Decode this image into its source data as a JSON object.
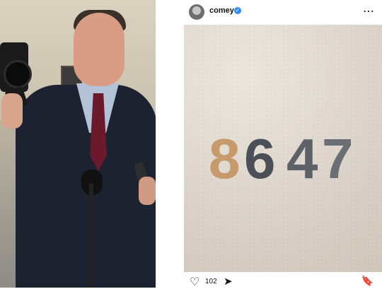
{
  "post": {
    "username": "comey",
    "verified_icon": "verified-badge-icon",
    "more_icon": "more-options-icon",
    "likes_count": "102",
    "actions": {
      "like_icon": "heart-icon",
      "share_icon": "send-icon",
      "save_icon": "bookmark-icon"
    },
    "image_caption_text": "8647"
  },
  "colors": {
    "verified": "#2d8cff",
    "text": "#111111"
  }
}
